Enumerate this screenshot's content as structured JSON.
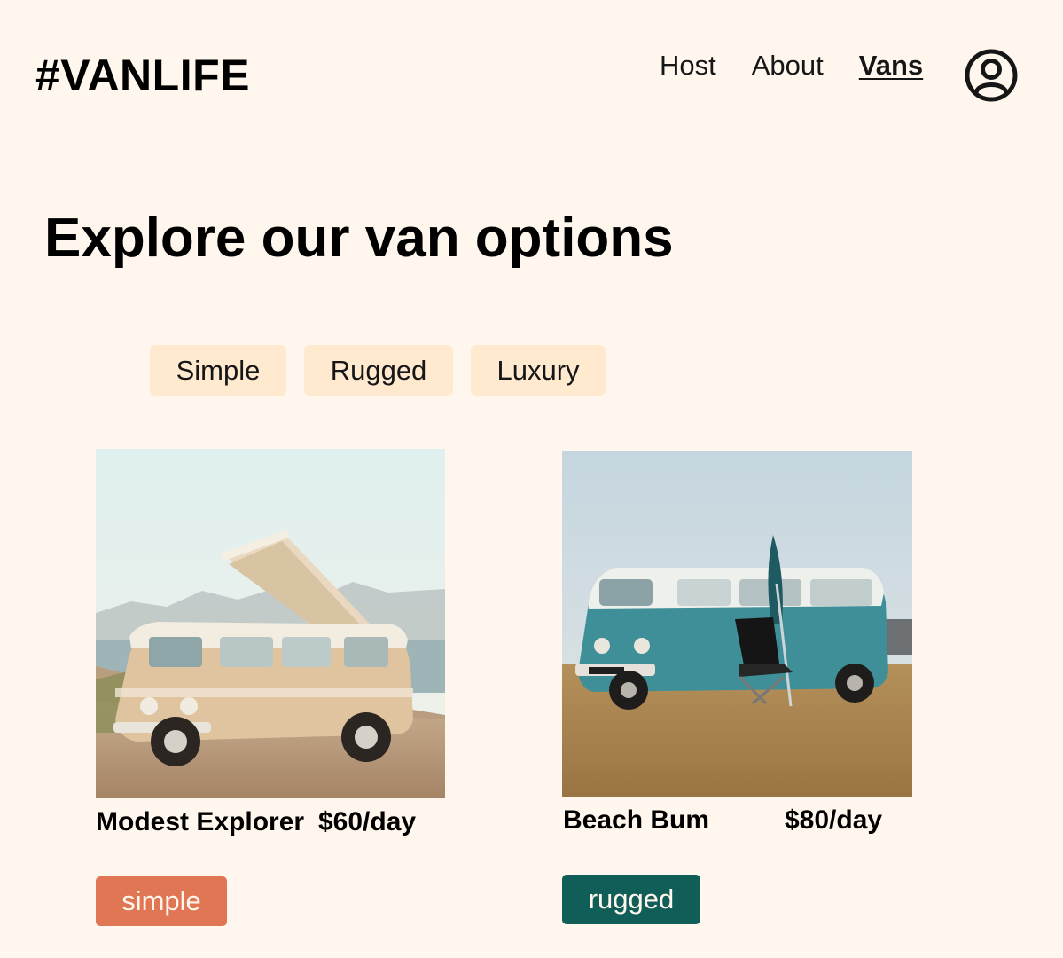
{
  "header": {
    "logo": "#VANLIFE",
    "nav": {
      "host": "Host",
      "about": "About",
      "vans": "Vans"
    }
  },
  "main": {
    "title": "Explore our van options",
    "filters": [
      "Simple",
      "Rugged",
      "Luxury"
    ],
    "vans": [
      {
        "name": "Modest Explorer",
        "price": "$60/day",
        "type": "simple",
        "type_color": "#E17654"
      },
      {
        "name": "Beach Bum",
        "price": "$80/day",
        "type": "rugged",
        "type_color": "#115E59"
      }
    ]
  },
  "colors": {
    "background": "#FFF7ED",
    "filter_bg": "#FFEAD0",
    "simple": "#E17654",
    "rugged": "#115E59"
  }
}
